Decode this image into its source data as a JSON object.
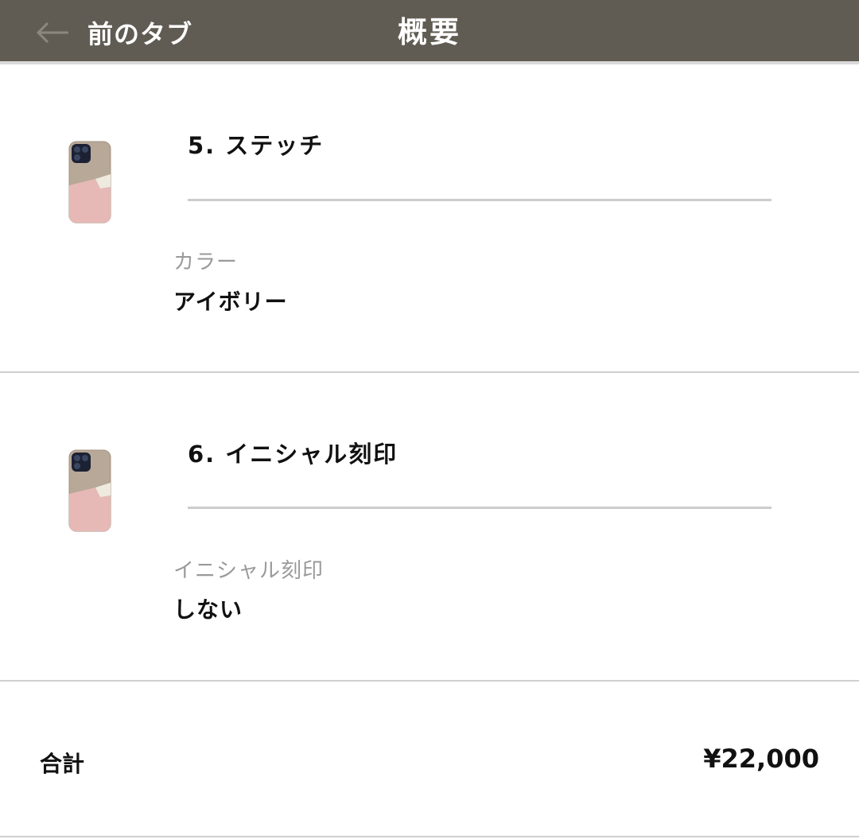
{
  "header": {
    "back_icon": "arrow-left-icon",
    "back_label": "前のタブ",
    "title": "概要"
  },
  "steps": [
    {
      "title": "5. ステッチ",
      "image_icon": "phone-case-thumbnail",
      "option_label": "カラー",
      "option_value": "アイボリー"
    },
    {
      "title": "6. イニシャル刻印",
      "image_icon": "phone-case-thumbnail",
      "option_label": "イニシャル刻印",
      "option_value": "しない"
    }
  ],
  "summary": {
    "total_label": "合計",
    "total_value": "¥22,000"
  },
  "colors": {
    "header_bg": "#605c53",
    "case_taupe": "#b8a898",
    "case_pink": "#e6b9b6",
    "case_ivory": "#efeae0",
    "camera": "#1c2233"
  }
}
